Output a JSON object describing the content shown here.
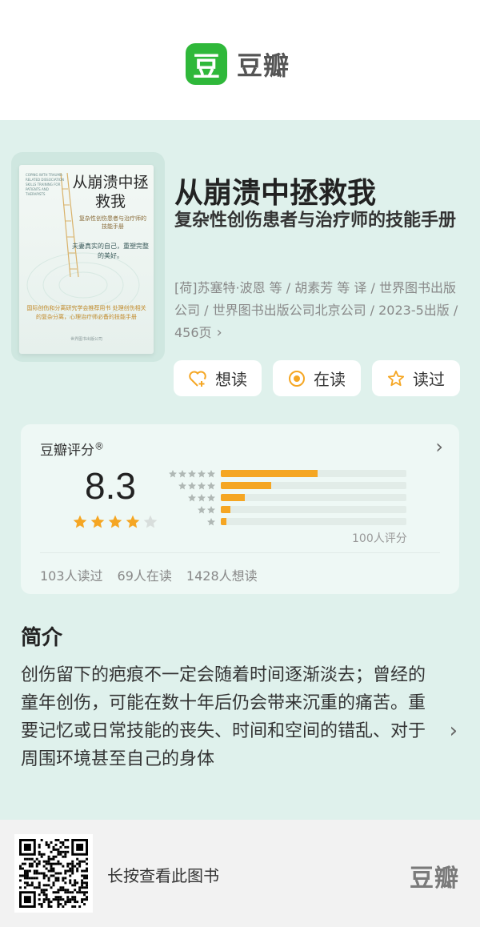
{
  "header": {
    "logo_glyph": "豆",
    "logo_text": "豆瓣"
  },
  "book": {
    "title": "从崩溃中拯救我",
    "subtitle": "复杂性创伤患者与治疗师的技能手册",
    "meta": "[荷]苏塞特·波恩 等 / 胡素芳 等 译 / 世界图书出版公司 / 世界图书出版公司北京公司 / 2023-5出版 / 456页",
    "cover": {
      "title": "从崩溃中拯救我",
      "subtitle": "复杂性创伤患者与治疗师的技能手册",
      "tagline": "夫妻真实的自己，重塑完整的美好。",
      "small": "COPING WITH TRAUMA-RELATED DISSOCIATION SKILLS TRAINING FOR PATIENTS AND THERAPISTS",
      "bottom": "国际创伤和分离研究学会推荐用书 处理创伤相关的复杂分离，心理治疗师必备的技能手册",
      "publisher": "世界图书出版公司"
    }
  },
  "actions": [
    {
      "label": "想读",
      "icon": "heart-plus-icon"
    },
    {
      "label": "在读",
      "icon": "target-icon"
    },
    {
      "label": "读过",
      "icon": "star-outline-icon"
    }
  ],
  "rating": {
    "heading": "豆瓣评分",
    "registered": "®",
    "score": "8.3",
    "star_value": 4,
    "count_label": "100人评分",
    "distribution": [
      {
        "stars": 5,
        "fraction": 0.52
      },
      {
        "stars": 4,
        "fraction": 0.27
      },
      {
        "stars": 3,
        "fraction": 0.13
      },
      {
        "stars": 2,
        "fraction": 0.05
      },
      {
        "stars": 1,
        "fraction": 0.03
      }
    ],
    "stats": [
      "103人读过",
      "69人在读",
      "1428人想读"
    ]
  },
  "intro": {
    "title": "简介",
    "text": "创伤留下的疤痕不一定会随着时间逐渐淡去；曾经的童年创伤，可能在数十年后仍会带来沉重的痛苦。重要记忆或日常技能的丧失、时间和空间的错乱、对于周围环境甚至自己的身体"
  },
  "footer": {
    "hint": "长按查看此图书",
    "logo_text": "豆瓣"
  },
  "colors": {
    "brand_green": "#2fb83a",
    "star_orange": "#f5a623",
    "mint_bg": "#dff1ec"
  }
}
